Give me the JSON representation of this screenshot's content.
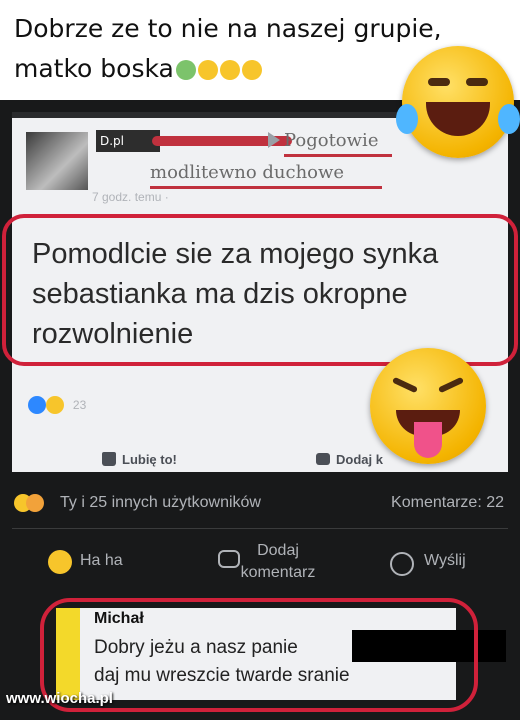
{
  "caption": {
    "line1": "Dobrze ze to nie na naszej grupie,",
    "line2": "matko boska",
    "emojis": [
      "person-raising-hands-icon",
      "grin-icon",
      "laughing-icon",
      "laughing-icon"
    ]
  },
  "post": {
    "author_tag": "D.pl",
    "group_name_line1": "Pogotowie",
    "group_name_line2": "modlitewno duchowe",
    "time": "7 godz. temu ·",
    "text": "Pomodlcie sie za mojego synka sebastianka ma dzis okropne rozwolnienie",
    "reaction_count": "23",
    "like_label": "Lubię to!",
    "comment_label": "Dodaj k"
  },
  "stats": {
    "reactions_text": "Ty i 25 innych użytkowników",
    "comments_text": "Komentarze: 22"
  },
  "actions": {
    "haha": "Ha ha",
    "comment_line1": "Dodaj",
    "comment_line2": "komentarz",
    "send": "Wyślij"
  },
  "comment": {
    "author": "Michał",
    "text_line1": "Dobry jeżu a nasz panie",
    "text_line2": "daj mu wreszcie twarde sranie"
  },
  "watermark": "www.wiocha.pl",
  "colors": {
    "highlight_red": "#d0213a",
    "dark_bg": "#18191a",
    "emoji_yellow": "#f7c52b"
  }
}
